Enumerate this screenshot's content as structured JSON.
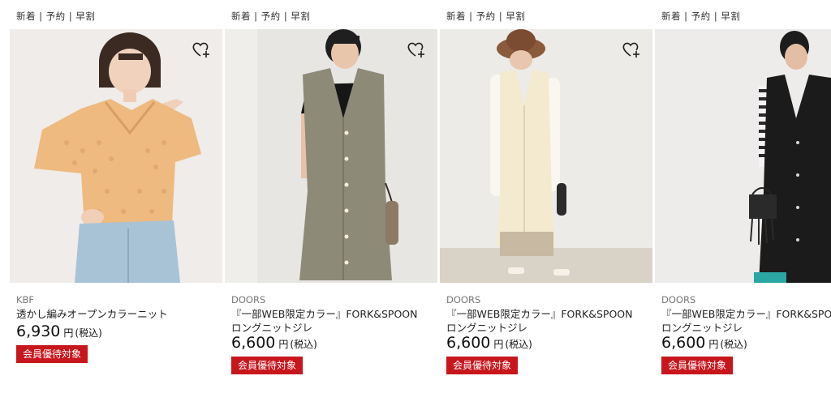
{
  "products": [
    {
      "tags": "新着 | 予約 | 早割",
      "brand": "KBF",
      "title": "透かし編みオープンカラーニット",
      "price": "6,930",
      "currency": "円",
      "tax": "(税込)",
      "badge": "会員優待対象"
    },
    {
      "tags": "新着 | 予約 | 早割",
      "brand": "DOORS",
      "title": "『一部WEB限定カラー』FORK&SPOON　ロングニットジレ",
      "price": "6,600",
      "currency": "円",
      "tax": "(税込)",
      "badge": "会員優待対象"
    },
    {
      "tags": "新着 | 予約 | 早割",
      "brand": "DOORS",
      "title": "『一部WEB限定カラー』FORK&SPOON　ロングニットジレ",
      "price": "6,600",
      "currency": "円",
      "tax": "(税込)",
      "badge": "会員優待対象"
    },
    {
      "tags": "新着 | 予約 | 早割",
      "brand": "DOORS",
      "title": "『一部WEB限定カラー』FORK&SPOON　ロングニットジレ",
      "price": "6,600",
      "currency": "円",
      "tax": "(税込)",
      "badge": "会員優待対象"
    }
  ],
  "icons": {
    "favorite": "heart-plus-icon"
  },
  "colors": {
    "badge": "#c8161d"
  }
}
